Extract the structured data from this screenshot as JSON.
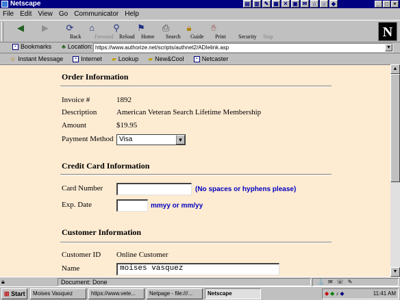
{
  "window": {
    "title": "Netscape"
  },
  "menu": [
    "File",
    "Edit",
    "View",
    "Go",
    "Communicator",
    "Help"
  ],
  "toolbar": {
    "buttons": [
      {
        "label": "Back",
        "icon": "back-arrow-icon"
      },
      {
        "label": "Forward",
        "icon": "forward-arrow-icon"
      },
      {
        "label": "Reload",
        "icon": "reload-icon"
      },
      {
        "label": "Home",
        "icon": "home-icon"
      },
      {
        "label": "Search",
        "icon": "search-icon"
      },
      {
        "label": "Guide",
        "icon": "guide-icon"
      },
      {
        "label": "Print",
        "icon": "print-icon"
      },
      {
        "label": "Security",
        "icon": "lock-icon"
      },
      {
        "label": "Stop",
        "icon": "stop-icon"
      }
    ]
  },
  "location": {
    "bookmarks_label": "Bookmarks",
    "location_label": "Location:",
    "url": "https://www.authorize.net/scripts/authnet2/ADIelink.asp"
  },
  "personal": [
    "Instant Message",
    "Internet",
    "Lookup",
    "New&Cool",
    "Netcaster"
  ],
  "order": {
    "heading": "Order Information",
    "invoice_label": "Invoice #",
    "invoice_value": "1892",
    "description_label": "Description",
    "description_value": "American Veteran Search Lifetime Membership",
    "amount_label": "Amount",
    "amount_value": "$19.95",
    "payment_label": "Payment Method",
    "payment_value": "Visa"
  },
  "card": {
    "heading": "Credit Card Information",
    "number_label": "Card Number",
    "number_value": "",
    "number_hint": "(No spaces or hyphens please)",
    "exp_label": "Exp. Date",
    "exp_value": "",
    "exp_hint": "mmyy or mm/yy"
  },
  "customer": {
    "heading": "Customer Information",
    "id_label": "Customer ID",
    "id_value": "Online Customer",
    "name_label": "Name",
    "name_value": "moises vasquez"
  },
  "status": {
    "message": "Document: Done"
  },
  "taskbar": {
    "start": "Start",
    "tasks": [
      "Moises Vasquez",
      "https://www.vete...",
      "Netpage - file:///...",
      "Netscape"
    ],
    "clock": "11:41 AM"
  }
}
